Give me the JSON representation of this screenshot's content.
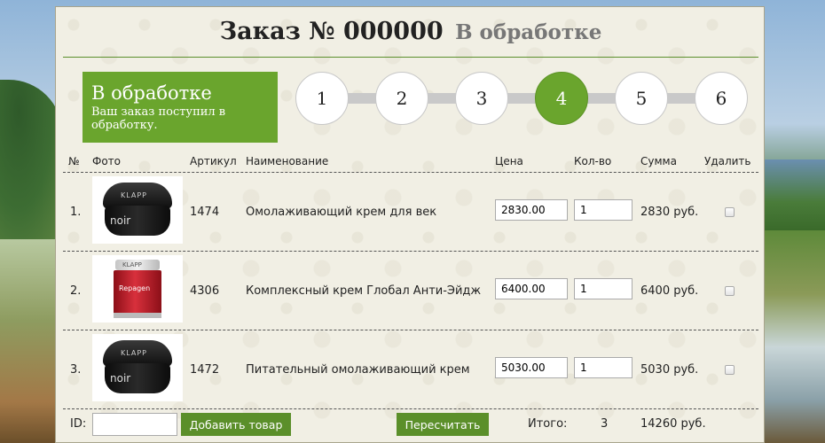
{
  "header": {
    "title": "Заказ № 000000",
    "status": "В обработке"
  },
  "status_box": {
    "title": "В обработке",
    "text": "Ваш заказ поступил в обработку."
  },
  "steps": [
    "1",
    "2",
    "3",
    "4",
    "5",
    "6"
  ],
  "active_step": 4,
  "table": {
    "headers": {
      "num": "№",
      "photo": "Фото",
      "sku": "Артикул",
      "name": "Наименование",
      "price": "Цена",
      "qty": "Кол-во",
      "sum": "Сумма",
      "delete": "Удалить"
    },
    "rows": [
      {
        "num": "1.",
        "sku": "1474",
        "name": "Омолаживающий крем для век",
        "price": "2830.00",
        "qty": "1",
        "sum": "2830 руб.",
        "photo_brand": "KLAPP",
        "photo_label": "noir"
      },
      {
        "num": "2.",
        "sku": "4306",
        "name": "Комплексный крем Глобал Анти-Эйдж",
        "price": "6400.00",
        "qty": "1",
        "sum": "6400 руб.",
        "photo_brand": "KLAPP",
        "photo_label": "Repagen"
      },
      {
        "num": "3.",
        "sku": "1472",
        "name": "Питательный омолаживающий крем",
        "price": "5030.00",
        "qty": "1",
        "sum": "5030 руб.",
        "photo_brand": "KLAPP",
        "photo_label": "noir"
      }
    ]
  },
  "footer": {
    "id_label": "ID:",
    "id_value": "",
    "add_button": "Добавить товар",
    "recalc_button": "Пересчитать",
    "total_label": "Итого:",
    "total_count": "3",
    "total_sum": "14260 руб."
  }
}
